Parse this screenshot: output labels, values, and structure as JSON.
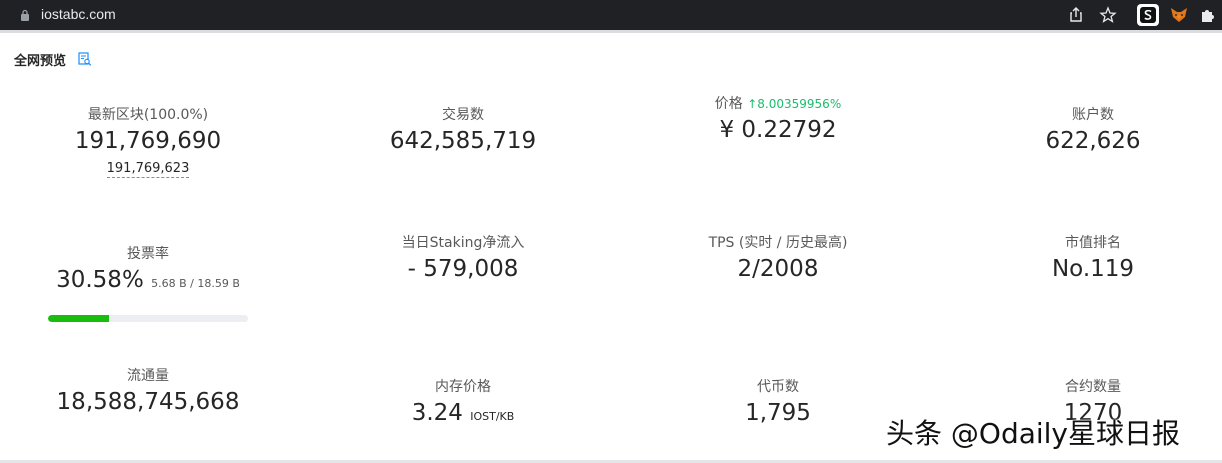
{
  "browser": {
    "url": "iostabc.com"
  },
  "section": {
    "title": "全网预览"
  },
  "stats": {
    "latest_block": {
      "label": "最新区块(100.0%)",
      "value": "191,769,690",
      "sub": "191,769,623"
    },
    "transactions": {
      "label": "交易数",
      "value": "642,585,719"
    },
    "price": {
      "label": "价格",
      "change": "↑8.00359956%",
      "value": "¥  0.22792"
    },
    "accounts": {
      "label": "账户数",
      "value": "622,626"
    },
    "vote_rate": {
      "label": "投票率",
      "value": "30.58%",
      "detail": "5.68 B / 18.59 B",
      "progress": 0.3058
    },
    "staking": {
      "label": "当日Staking净流入",
      "value": "- 579,008"
    },
    "tps": {
      "label": "TPS (实时 / 历史最高)",
      "value": "2/2008"
    },
    "market_rank": {
      "label": "市值排名",
      "value": "No.119"
    },
    "circulating": {
      "label": "流通量",
      "value": "18,588,745,668"
    },
    "ram_price": {
      "label": "内存价格",
      "value": "3.24",
      "unit": "IOST/KB"
    },
    "tokens": {
      "label": "代币数",
      "value": "1,795"
    },
    "contracts": {
      "label": "合约数量",
      "value": "1270"
    }
  },
  "watermark": "头条 @Odaily星球日报",
  "colors": {
    "progress": "#19be0d",
    "price_up": "#19be6b",
    "icon_blue": "#1890ff"
  }
}
